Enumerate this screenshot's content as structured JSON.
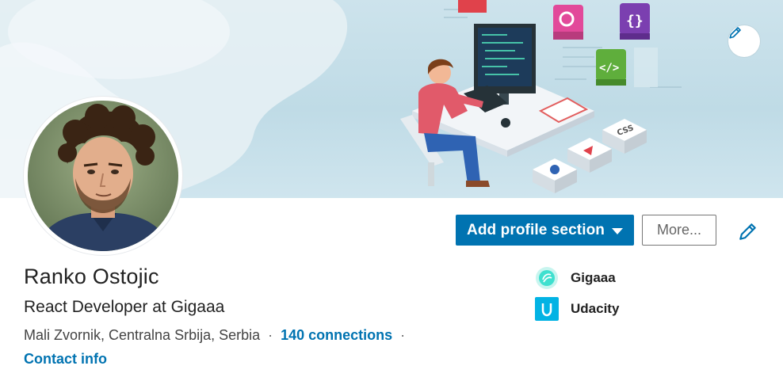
{
  "profile": {
    "name": "Ranko Ostojic",
    "headline": "React Developer at Gigaaa",
    "location": "Mali Zvornik, Centralna Srbija, Serbia",
    "separator": "·",
    "connections": "140 connections",
    "contact_info": "Contact info"
  },
  "actions": {
    "add_section": "Add profile section",
    "more": "More..."
  },
  "orgs": [
    {
      "name": "Gigaaa",
      "icon": "gigaaa-logo-icon"
    },
    {
      "name": "Udacity",
      "icon": "udacity-logo-icon"
    }
  ],
  "colors": {
    "primary": "#0073b1",
    "banner": "#c5dfe9",
    "text": "#222222"
  }
}
